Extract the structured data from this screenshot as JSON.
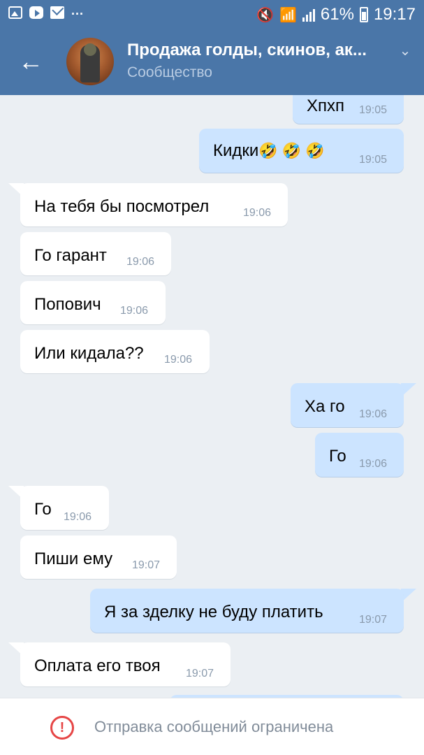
{
  "status_bar": {
    "more": "...",
    "battery": "61%",
    "time": "19:17",
    "icons": [
      "photo-icon",
      "youtube-icon",
      "mail-icon",
      "mute-icon",
      "wifi-icon",
      "signal-icon",
      "battery-icon"
    ]
  },
  "header": {
    "title": "Продажа голды, скинов, ак...",
    "subtitle": "Сообщество",
    "colors": {
      "bar": "#4a76a8",
      "subtitle": "#b8cbe2"
    }
  },
  "messages": [
    {
      "dir": "out",
      "text": "Хпхп",
      "time": "19:05"
    },
    {
      "dir": "out",
      "text": "Кидки",
      "emoji": "🤣 🤣 🤣",
      "time": "19:05"
    },
    {
      "dir": "in",
      "text": "На тебя бы посмотрел",
      "time": "19:06"
    },
    {
      "dir": "in",
      "text": "Го гарант",
      "time": "19:06"
    },
    {
      "dir": "in",
      "text": "Попович",
      "time": "19:06"
    },
    {
      "dir": "in",
      "text": "Или кидала??",
      "time": "19:06"
    },
    {
      "dir": "out",
      "text": "Ха го",
      "time": "19:06"
    },
    {
      "dir": "out",
      "text": "Го",
      "time": "19:06"
    },
    {
      "dir": "in",
      "text": "Го",
      "time": "19:06"
    },
    {
      "dir": "in",
      "text": "Пиши ему",
      "time": "19:07"
    },
    {
      "dir": "out",
      "text": "Я за зделку не буду платить",
      "time": "19:07"
    },
    {
      "dir": "in",
      "text": "Оплата его твоя",
      "time": "19:07"
    }
  ],
  "bottom": {
    "notice": "Отправка сообщений ограничена",
    "icon_glyph": "!",
    "colors": {
      "icon": "#e64646",
      "text": "#818c99"
    }
  },
  "colors": {
    "background": "#ebeff3",
    "incoming": "#ffffff",
    "outgoing": "#cce4ff"
  }
}
